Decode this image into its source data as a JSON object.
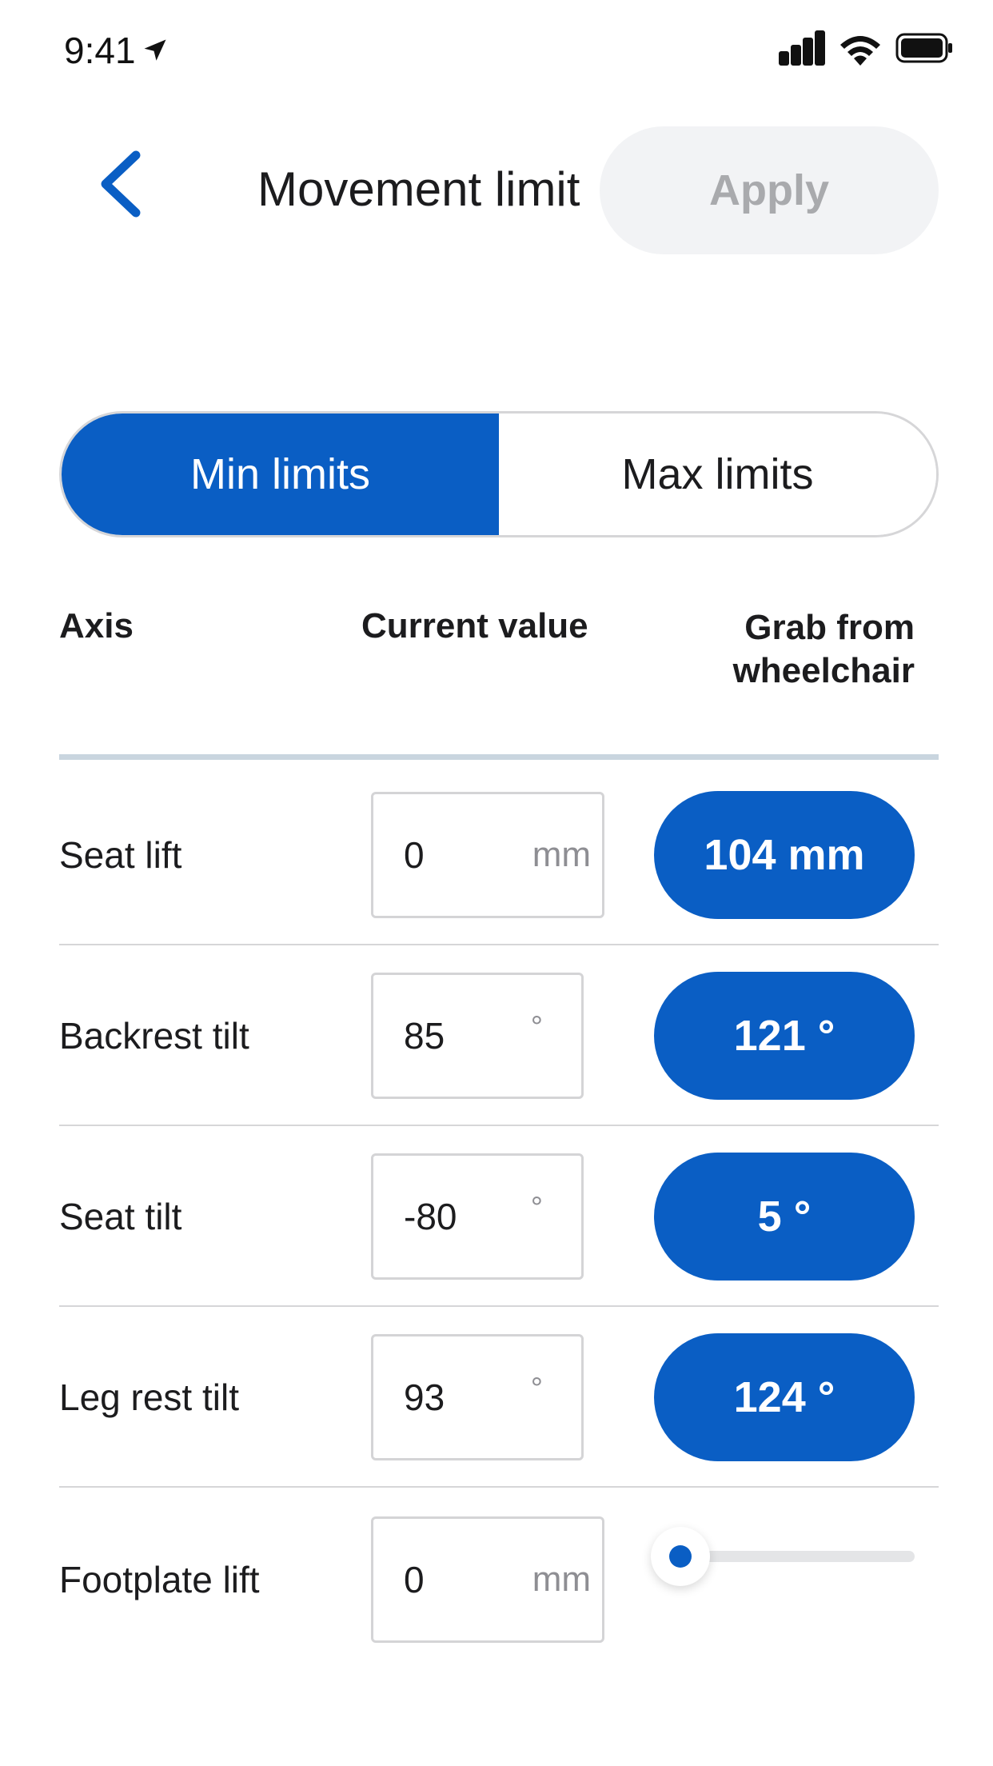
{
  "status_bar": {
    "time": "9:41"
  },
  "header": {
    "title": "Movement limit",
    "apply_label": "Apply"
  },
  "segments": {
    "min_label": "Min limits",
    "max_label": "Max limits",
    "selected": "Min limits"
  },
  "columns": {
    "axis": "Axis",
    "current_value": "Current value",
    "grab_line1": "Grab from",
    "grab_line2": "wheelchair"
  },
  "rows": [
    {
      "axis": "Seat lift",
      "value": "0",
      "unit": "mm",
      "grab": "104 mm"
    },
    {
      "axis": "Backrest tilt",
      "value": "85",
      "unit": "°",
      "grab": "121 °"
    },
    {
      "axis": "Seat tilt",
      "value": "-80",
      "unit": "°",
      "grab": "5 °"
    },
    {
      "axis": "Leg rest tilt",
      "value": "93",
      "unit": "°",
      "grab": "124 °"
    },
    {
      "axis": "Footplate lift",
      "value": "0",
      "unit": "mm",
      "slider_level": 0
    }
  ],
  "colors": {
    "accent": "#0a5ec4",
    "apply_bg": "#f2f3f5",
    "apply_text": "#a9aaad",
    "divider": "#d6d6d8",
    "header_divider": "#c9d5df"
  }
}
